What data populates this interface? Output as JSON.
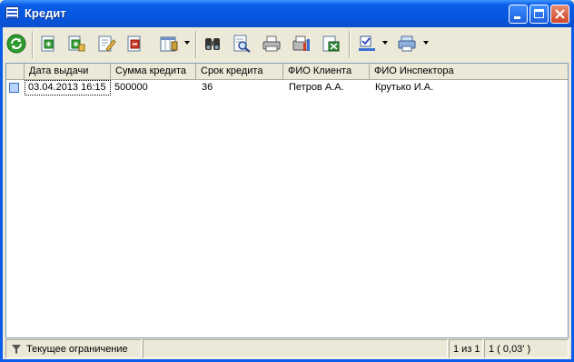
{
  "window": {
    "title": "Кредит"
  },
  "toolbar": {
    "buttons": [
      {
        "name": "refresh-icon"
      },
      {
        "name": "add-record-icon"
      },
      {
        "name": "add-copy-icon"
      },
      {
        "name": "edit-record-icon"
      },
      {
        "name": "delete-record-icon"
      },
      {
        "name": "column-settings-icon"
      },
      {
        "name": "binoculars-search-icon"
      },
      {
        "name": "preview-icon"
      },
      {
        "name": "print-icon"
      },
      {
        "name": "report-icon"
      },
      {
        "name": "export-excel-icon"
      },
      {
        "name": "filter-check-icon"
      },
      {
        "name": "print-setup-icon"
      }
    ]
  },
  "grid": {
    "columns": [
      "Дата выдачи",
      "Сумма кредита",
      "Срок кредита",
      "ФИО Клиента",
      "ФИО Инспектора"
    ],
    "rows": [
      [
        "03.04.2013 16:15",
        "500000",
        "36",
        "Петров А.А.",
        "Крутько И.А."
      ]
    ]
  },
  "status": {
    "filter_label": "Текущее ограничение",
    "record_position": "1 из 1",
    "count_time": "1 ( 0,03' )"
  },
  "colors": {
    "titlebar": "#0a5de8",
    "face": "#ece9d8",
    "grid_border": "#7f9db9"
  }
}
